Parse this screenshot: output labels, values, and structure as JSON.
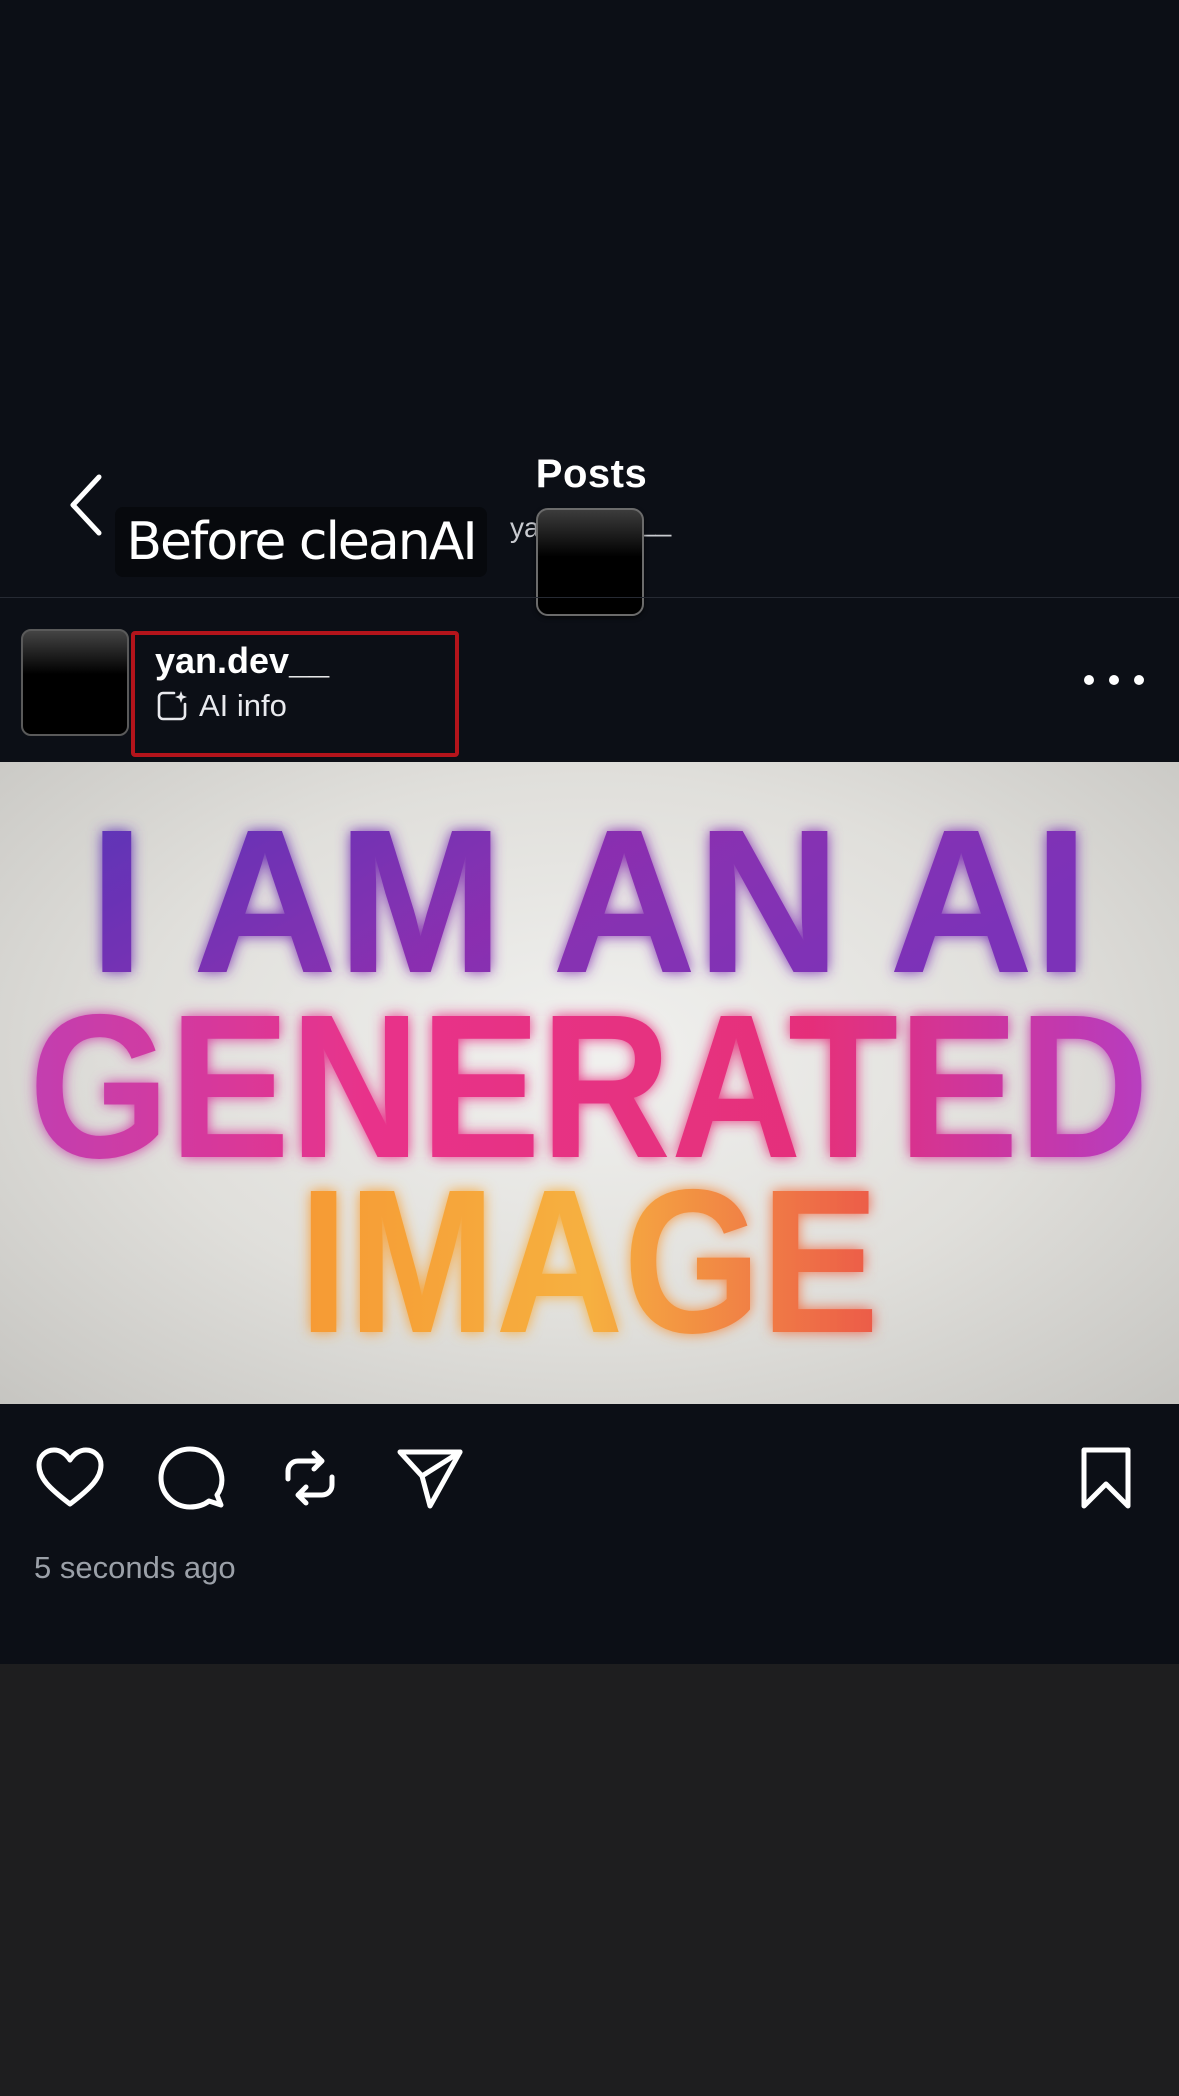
{
  "header": {
    "title": "Posts",
    "subtitle_prefix": "ya",
    "subtitle_suffix": "__",
    "back_icon": "chevron-left-icon"
  },
  "overlay": {
    "label": "Before cleanAI"
  },
  "post": {
    "username": "yan.dev__",
    "ai_info_label": "AI info",
    "ai_info_icon": "ai-sparkle-icon",
    "more_icon": "more-horizontal-icon",
    "image_text": {
      "line1": "I AM AN AI",
      "line2": "GENERATED",
      "line3": "IMAGE"
    },
    "timestamp": "5 seconds ago"
  },
  "actions": [
    {
      "name": "like-button",
      "icon": "heart-icon"
    },
    {
      "name": "comment-button",
      "icon": "comment-icon"
    },
    {
      "name": "repost-button",
      "icon": "repost-icon"
    },
    {
      "name": "share-button",
      "icon": "send-icon"
    },
    {
      "name": "save-button",
      "icon": "bookmark-icon"
    }
  ],
  "colors": {
    "app_background": "#0c0f16",
    "page_background": "#1e1e1f",
    "highlight_outline": "#b4141b",
    "gradient_purple": "#5a35b8",
    "gradient_pink": "#e8338a",
    "gradient_orange": "#f6a63a"
  }
}
